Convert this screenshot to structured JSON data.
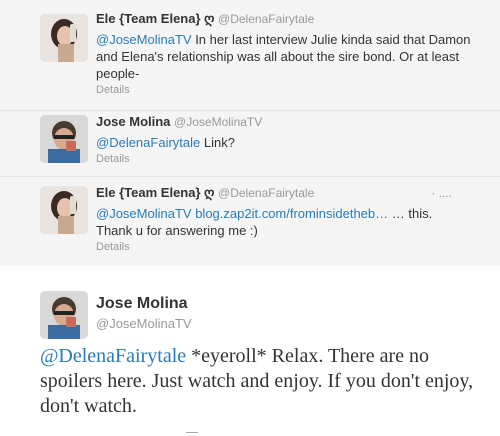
{
  "replies": [
    {
      "name": "Ele {Team Elena}",
      "symbol": "ღ",
      "handle": "@DelenaFairytale",
      "mention": "@JoseMolinaTV",
      "text": " In her last interview Julie kinda said that Damon and Elena's relationship was all about the sire bond. Or at least people-",
      "details": "Details"
    },
    {
      "name": "Jose Molina",
      "handle": "@JoseMolinaTV",
      "mention": "@DelenaFairytale",
      "text": " Link?",
      "details": "Details"
    },
    {
      "name": "Ele {Team Elena}",
      "symbol": "ღ",
      "handle": "@DelenaFairytale",
      "dots": "· ....",
      "mention": "@JoseMolinaTV",
      "link": "blog.zap2it.com/frominsidetheb…",
      "text_after_link": " … this.",
      "text_line2": "Thank u for answering me :)",
      "details": "Details"
    }
  ],
  "main_tweet": {
    "name": "Jose Molina",
    "handle": "@JoseMolinaTV",
    "mention": "@DelenaFairytale",
    "text": " *eyeroll* Relax. There are no spoilers here. Just watch and enjoy. If you don't enjoy, don't watch."
  },
  "colors": {
    "link": "#2b7bb9",
    "reply_background": "#f5f5f5",
    "muted": "#999999"
  }
}
